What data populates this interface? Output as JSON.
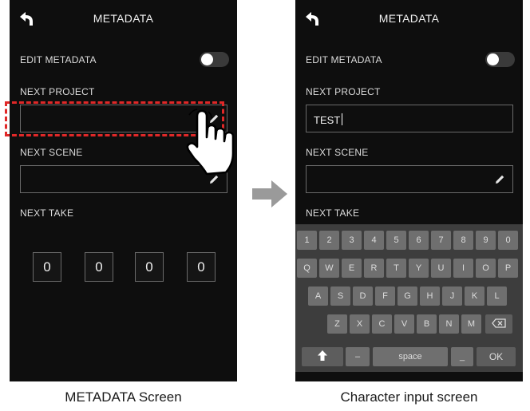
{
  "left_screen": {
    "title": "METADATA",
    "edit_metadata_label": "EDIT METADATA",
    "next_project_label": "NEXT PROJECT",
    "next_scene_label": "NEXT SCENE",
    "next_take_label": "NEXT TAKE",
    "take_digits": [
      "0",
      "0",
      "0",
      "0"
    ],
    "edit_metadata_on": false
  },
  "right_screen": {
    "title": "METADATA",
    "edit_metadata_label": "EDIT METADATA",
    "next_project_label": "NEXT PROJECT",
    "next_project_value": "TEST",
    "next_scene_label": "NEXT SCENE",
    "next_take_label": "NEXT TAKE",
    "edit_metadata_on": false
  },
  "keyboard": {
    "row1": [
      "1",
      "2",
      "3",
      "4",
      "5",
      "6",
      "7",
      "8",
      "9",
      "0"
    ],
    "row2": [
      "Q",
      "W",
      "E",
      "R",
      "T",
      "Y",
      "U",
      "I",
      "O",
      "P"
    ],
    "row3": [
      "A",
      "S",
      "D",
      "F",
      "G",
      "H",
      "J",
      "K",
      "L"
    ],
    "row4": [
      "Z",
      "X",
      "C",
      "V",
      "B",
      "N",
      "M"
    ],
    "dash_key": "–",
    "space_key": "space",
    "underscore_key": "_",
    "ok_key": "OK"
  },
  "captions": {
    "left": "METADATA Screen",
    "right": "Character input screen"
  },
  "colors": {
    "screen_bg": "#0e0e0e",
    "highlight": "#e02828",
    "arrow": "#9a9a9a"
  }
}
